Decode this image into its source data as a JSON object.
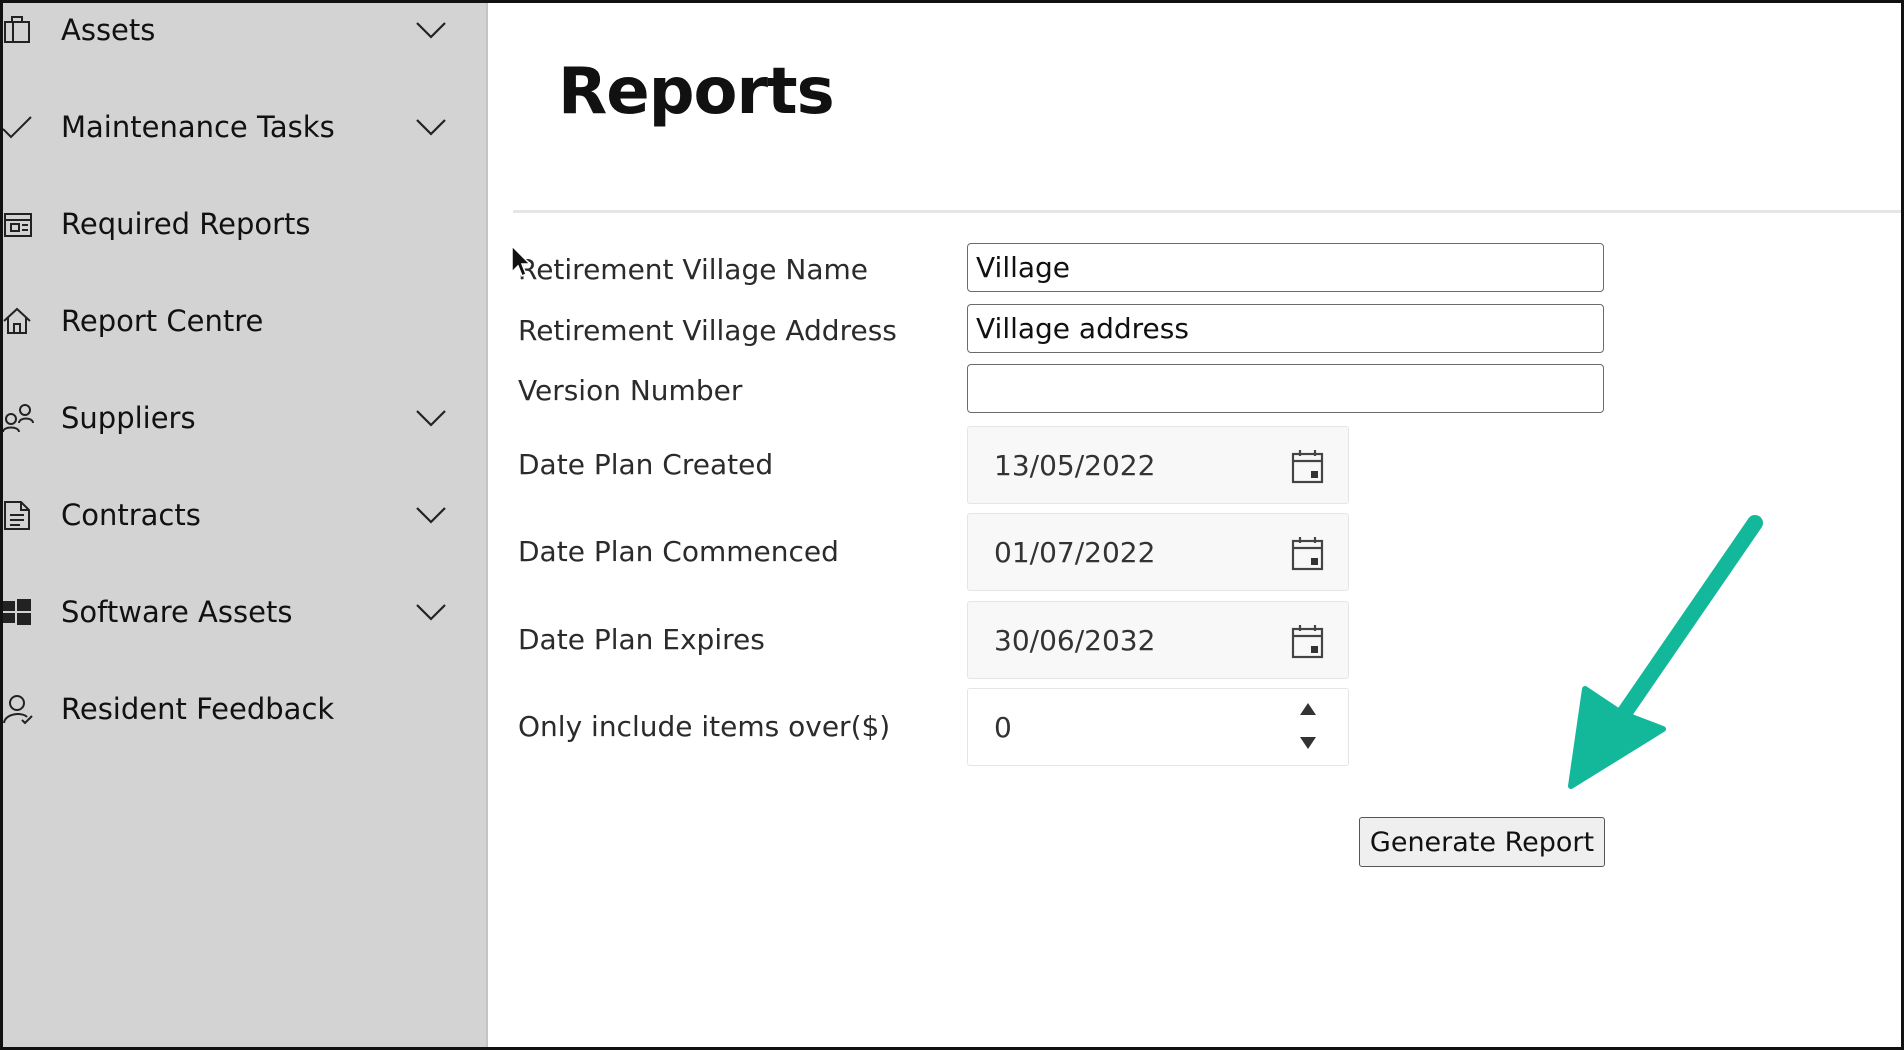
{
  "sidebar": {
    "items": [
      {
        "label": "Assets",
        "icon": "briefcase-icon",
        "expandable": true
      },
      {
        "label": "Maintenance Tasks",
        "icon": "checkmark-icon",
        "expandable": true
      },
      {
        "label": "Required Reports",
        "icon": "report-icon",
        "expandable": false
      },
      {
        "label": "Report Centre",
        "icon": "home-icon",
        "expandable": false
      },
      {
        "label": "Suppliers",
        "icon": "people-icon",
        "expandable": true
      },
      {
        "label": "Contracts",
        "icon": "document-icon",
        "expandable": true
      },
      {
        "label": "Software Assets",
        "icon": "windows-icon",
        "expandable": true
      },
      {
        "label": "Resident Feedback",
        "icon": "person-check-icon",
        "expandable": false
      }
    ]
  },
  "main": {
    "title": "Reports",
    "fields": {
      "village_name": {
        "label": "Retirement Village Name",
        "value": "Village"
      },
      "village_address": {
        "label": "Retirement Village Address",
        "value": "Village address"
      },
      "version_number": {
        "label": "Version Number",
        "value": ""
      },
      "date_created": {
        "label": "Date Plan Created",
        "value": "13/05/2022"
      },
      "date_commenced": {
        "label": "Date Plan Commenced",
        "value": "01/07/2022"
      },
      "date_expires": {
        "label": "Date Plan Expires",
        "value": "30/06/2032"
      },
      "min_amount": {
        "label": "Only include items over($)",
        "value": "0"
      }
    },
    "generate_label": "Generate Report"
  },
  "annotation": {
    "arrow_color": "#13b89a"
  }
}
